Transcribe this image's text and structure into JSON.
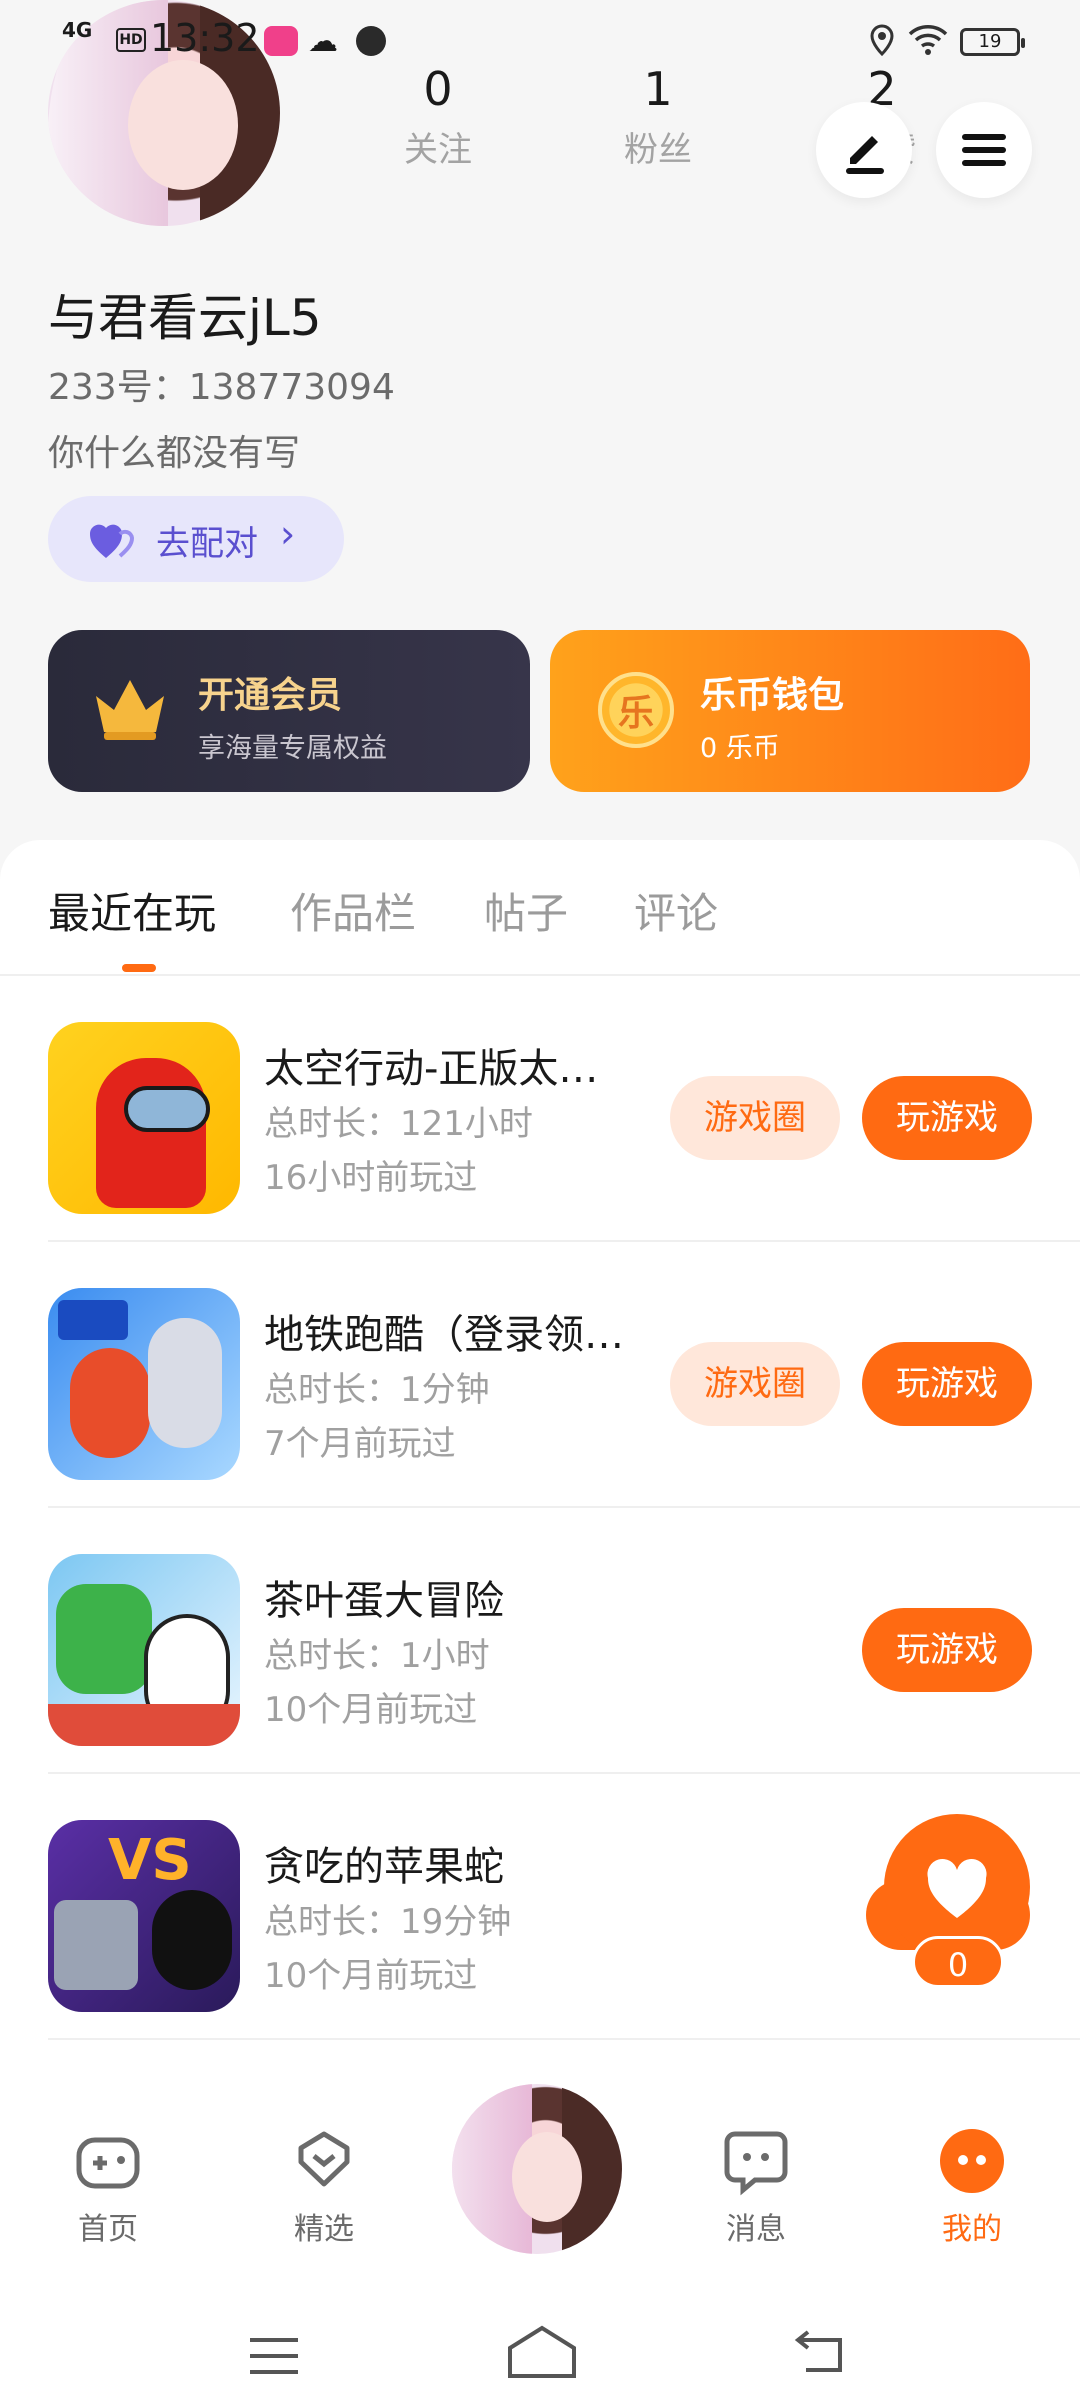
{
  "status_bar": {
    "network": "4G",
    "hd": "HD",
    "time": "13:32",
    "battery": "19"
  },
  "profile": {
    "stats": [
      {
        "value": "0",
        "label": "关注"
      },
      {
        "value": "1",
        "label": "粉丝"
      },
      {
        "value": "2",
        "label": "获赞"
      }
    ],
    "username": "与君看云jL5",
    "id_text": "233号：138773094",
    "bio": "你什么都没有写",
    "match_label": "去配对"
  },
  "cards": {
    "vip": {
      "title": "开通会员",
      "subtitle": "享海量专属权益"
    },
    "wallet": {
      "title": "乐币钱包",
      "subtitle": "0 乐币",
      "coin_glyph": "乐"
    }
  },
  "tabs": [
    "最近在玩",
    "作品栏",
    "帖子",
    "评论"
  ],
  "games": [
    {
      "name": "太空行动-正版太…",
      "duration": "总时长：121小时",
      "last": "16小时前玩过",
      "circle_label": "游戏圈",
      "play_label": "玩游戏"
    },
    {
      "name": "地铁跑酷（登录领…",
      "duration": "总时长：1分钟",
      "last": "7个月前玩过",
      "circle_label": "游戏圈",
      "play_label": "玩游戏"
    },
    {
      "name": "茶叶蛋大冒险",
      "duration": "总时长：1小时",
      "last": "10个月前玩过",
      "play_label": "玩游戏"
    },
    {
      "name": "贪吃的苹果蛇",
      "duration": "总时长：19分钟",
      "last": "10个月前玩过"
    }
  ],
  "fab": {
    "count": "0"
  },
  "bottom_nav": [
    {
      "label": "首页",
      "icon": "gamepad-icon"
    },
    {
      "label": "精选",
      "icon": "heart-box-icon"
    },
    {
      "label": "消息",
      "icon": "chat-icon"
    },
    {
      "label": "我的",
      "icon": "me-icon"
    }
  ],
  "colors": {
    "accent": "#ff6a12",
    "vip_gold": "#f7d38d",
    "match_purple": "#5a4fcf"
  }
}
